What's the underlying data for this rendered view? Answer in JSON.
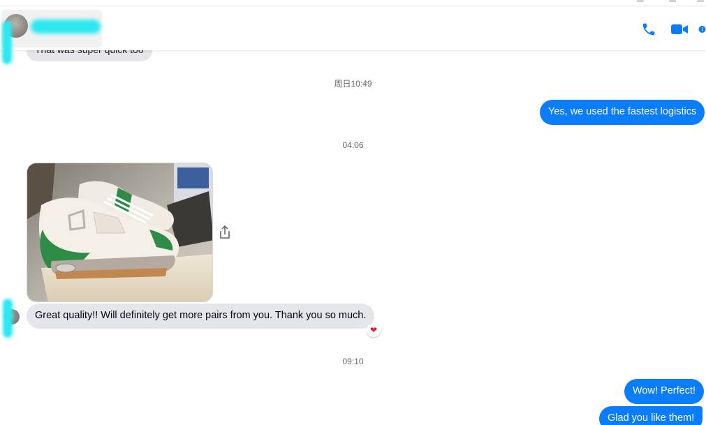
{
  "header": {
    "contact_name": "",
    "icons": [
      "phone-icon",
      "video-camera-icon",
      "info-icon"
    ],
    "accent_color": "#0a7cff"
  },
  "messages": [
    {
      "direction": "incoming",
      "text": "That was super quick too"
    },
    {
      "direction": "timestamp",
      "text": "周日10:49"
    },
    {
      "direction": "outgoing",
      "text": "Yes, we used the fastest logistics"
    },
    {
      "direction": "timestamp",
      "text": "04:06"
    },
    {
      "direction": "incoming",
      "type": "image",
      "alt": "sneakers-photo"
    },
    {
      "direction": "incoming",
      "text": "Great quality!! Will definitely get more pairs from you. Thank you so much.",
      "reaction": "heart"
    },
    {
      "direction": "timestamp",
      "text": "09:10"
    },
    {
      "direction": "outgoing",
      "text": "Wow! Perfect!"
    },
    {
      "direction": "outgoing",
      "text": "Glad you like them!"
    }
  ],
  "colors": {
    "incoming_bubble": "#e4e6eb",
    "outgoing_bubble": "#0a7cff",
    "timestamp": "#65676b",
    "reaction": "#e41e3f"
  }
}
